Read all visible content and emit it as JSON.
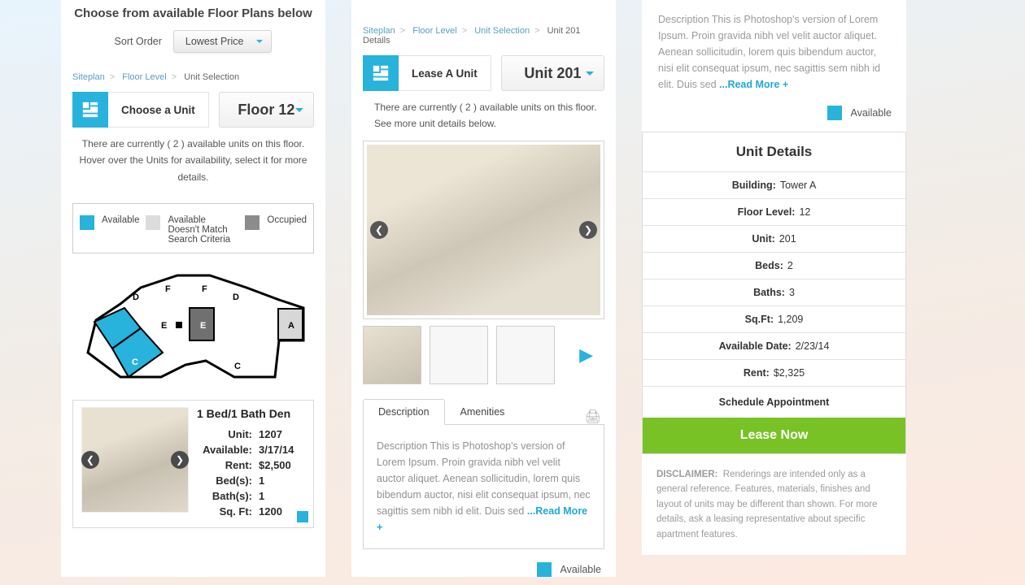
{
  "col1": {
    "title": "Choose from available Floor Plans below",
    "sort_label": "Sort Order",
    "sort_value": "Lowest Price",
    "crumb1": "Siteplan",
    "crumb2": "Floor Level",
    "crumb3": "Unit Selection",
    "choose_label": "Choose a Unit",
    "floor_value": "Floor 12",
    "note1": "There are currently  ( 2 ) available units on this floor.",
    "note2": "Hover over the Units for availability, select it for more details.",
    "legend": {
      "available": "Available",
      "nomatch": "Available Doesn't Match Search Criteria",
      "occupied": "Occupied"
    },
    "tooltip": {
      "title": "1 Bed/1 Bath Den",
      "unit_k": "Unit:",
      "unit_v": "1207",
      "avail_k": "Available:",
      "avail_v": "3/17/14",
      "rent_k": "Rent:",
      "rent_v": "$2,500",
      "bed_k": "Bed(s):",
      "bed_v": "1",
      "bath_k": "Bath(s):",
      "bath_v": "1",
      "sqft_k": "Sq. Ft:",
      "sqft_v": "1200"
    }
  },
  "col2": {
    "crumb1": "Siteplan",
    "crumb2": "Floor Level",
    "crumb3": "Unit Selection",
    "crumb4": "Unit 201 Details",
    "lease_label": "Lease A Unit",
    "unit_value": "Unit 201",
    "note1": "There are currently  ( 2 ) available units on this floor.",
    "note2": "See more unit details below.",
    "tab_desc": "Description",
    "tab_amen": "Amenities",
    "desc_text": "Description This is Photoshop's version  of Lorem Ipsum. Proin gravida nibh vel velit auctor aliquet. Aenean sollicitudin, lorem quis bibendum auctor, nisi elit consequat ipsum, nec sagittis sem nibh id elit. Duis sed ",
    "readmore": "...Read More +",
    "available": "Available"
  },
  "col3": {
    "desc_text": "Description This is Photoshop's version  of Lorem Ipsum. Proin gravida nibh vel velit auctor aliquet. Aenean sollicitudin, lorem quis bibendum auctor, nisi elit consequat ipsum, nec sagittis sem nibh id elit. Duis sed ",
    "readmore": "...Read More +",
    "available": "Available",
    "title": "Unit Details",
    "rows": {
      "building_k": "Building:",
      "building_v": "Tower A",
      "floor_k": "Floor Level:",
      "floor_v": "12",
      "unit_k": "Unit:",
      "unit_v": "201",
      "beds_k": "Beds:",
      "beds_v": "2",
      "baths_k": "Baths:",
      "baths_v": "3",
      "sqft_k": "Sq.Ft:",
      "sqft_v": "1,209",
      "availdate_k": "Available Date:",
      "availdate_v": "2/23/14",
      "rent_k": "Rent:",
      "rent_v": "$2,325"
    },
    "schedule": "Schedule Appointment",
    "lease_now": "Lease Now",
    "disclaimer_label": "DISCLAIMER:",
    "disclaimer_text": "Renderings are intended only as a general reference. Features, materials, finishes and layout of units may be different than shown. For more details, ask a leasing representative about specific apartment features."
  }
}
